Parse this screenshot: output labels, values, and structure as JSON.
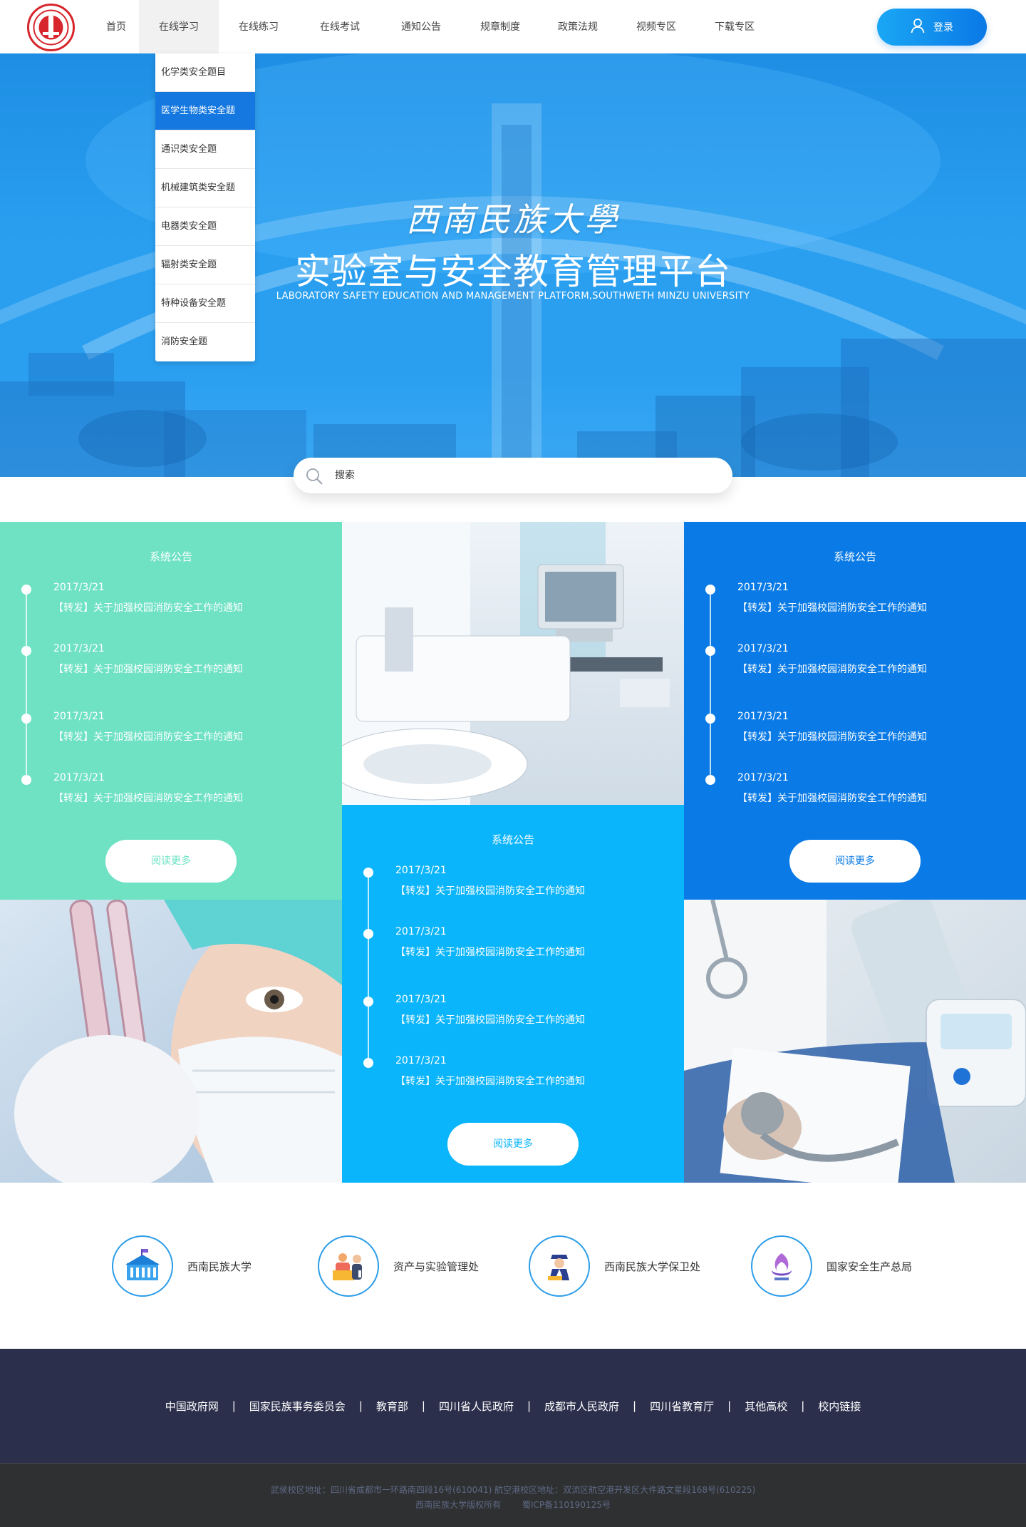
{
  "header": {
    "logo_text": "西南民族大学",
    "nav": [
      {
        "label": "首页",
        "icon": null
      },
      {
        "label": "在线学习"
      },
      {
        "label": "在线练习"
      },
      {
        "label": "在线考试"
      },
      {
        "label": "通知公告"
      },
      {
        "label": "规章制度"
      },
      {
        "label": "政策法规"
      },
      {
        "label": "视频专区"
      },
      {
        "label": "下载专区"
      }
    ],
    "active_nav": "在线学习",
    "login_label": "登录",
    "login_icon": "user-icon"
  },
  "dropdown": {
    "items": [
      {
        "label": "化学类安全题目"
      },
      {
        "label": "医学生物类安全题"
      },
      {
        "label": "通识类安全题"
      },
      {
        "label": "机械建筑类安全题"
      },
      {
        "label": "电器类安全题"
      },
      {
        "label": "辐射类安全题"
      },
      {
        "label": "特种设备安全题"
      },
      {
        "label": "消防安全题"
      }
    ],
    "active_item": "医学生物类安全题"
  },
  "hero": {
    "calligraphy": "西南民族大學",
    "title": "实验室与安全教育管理平台",
    "subtitle": "LABORATORY SAFETY EDUCATION AND MANAGEMENT PLATFORM,SOUTHWETH MINZU UNIVERSITY"
  },
  "search": {
    "placeholder": "搜索",
    "icon": "search-icon"
  },
  "panels": [
    {
      "title": "系统公告",
      "color": "#6fe2c4",
      "button_text_color": "#6fe2c4",
      "items": [
        {
          "date": "2017/3/21",
          "title": "【转发】关于加强校园消防安全工作的通知"
        },
        {
          "date": "2017/3/21",
          "title": "【转发】关于加强校园消防安全工作的通知"
        },
        {
          "date": "2017/3/21",
          "title": "【转发】关于加强校园消防安全工作的通知"
        },
        {
          "date": "2017/3/21",
          "title": "【转发】关于加强校园消防安全工作的通知"
        }
      ],
      "more_label": "阅读更多"
    },
    {
      "title": "系统公告",
      "color": "#0bb5fb",
      "button_text_color": "#0bb5fb",
      "items": [
        {
          "date": "2017/3/21",
          "title": "【转发】关于加强校园消防安全工作的通知"
        },
        {
          "date": "2017/3/21",
          "title": "【转发】关于加强校园消防安全工作的通知"
        },
        {
          "date": "2017/3/21",
          "title": "【转发】关于加强校园消防安全工作的通知"
        },
        {
          "date": "2017/3/21",
          "title": "【转发】关于加强校园消防安全工作的通知"
        }
      ],
      "more_label": "阅读更多"
    },
    {
      "title": "系统公告",
      "color": "#0a7be6",
      "button_text_color": "#0a7be6",
      "items": [
        {
          "date": "2017/3/21",
          "title": "【转发】关于加强校园消防安全工作的通知"
        },
        {
          "date": "2017/3/21",
          "title": "【转发】关于加强校园消防安全工作的通知"
        },
        {
          "date": "2017/3/21",
          "title": "【转发】关于加强校园消防安全工作的通知"
        },
        {
          "date": "2017/3/21",
          "title": "【转发】关于加强校园消防安全工作的通知"
        }
      ],
      "more_label": "阅读更多"
    }
  ],
  "partners": [
    {
      "name": "西南民族大学",
      "icon": "university-building-icon"
    },
    {
      "name": "资产与实验管理处",
      "icon": "office-staff-icon"
    },
    {
      "name": "西南民族大学保卫处",
      "icon": "security-guard-icon"
    },
    {
      "name": "国家安全生产总局",
      "icon": "safety-emblem-icon"
    }
  ],
  "footer": {
    "links": [
      {
        "label": "中国政府网"
      },
      {
        "label": "国家民族事务委员会"
      },
      {
        "label": "教育部"
      },
      {
        "label": "四川省人民政府"
      },
      {
        "label": "成都市人民政府"
      },
      {
        "label": "四川省教育厅"
      },
      {
        "label": "其他高校"
      },
      {
        "label": "校内链接"
      }
    ],
    "separator": "|",
    "address": "武侯校区地址：四川省成都市一环路南四段16号(610041)  航空港校区地址：双流区航空港开发区大件路文星段168号(610225)",
    "copyright": "西南民族大学版权所有",
    "icp": "蜀ICP备110190125号"
  },
  "colors": {
    "brand_blue": "#0a79e6",
    "mint": "#6fe2c4",
    "sky": "#0bb5fb",
    "footer_dark": "#2c2f4c"
  }
}
